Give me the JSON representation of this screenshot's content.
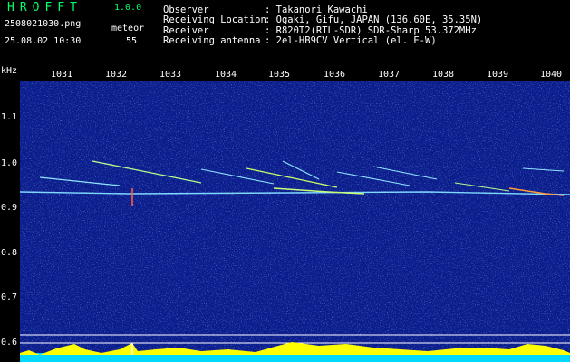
{
  "app": {
    "name": "HROFFT",
    "version": "1.0.0"
  },
  "file": {
    "name": "2508021030.png",
    "timestamp": "25.08.02 10:30"
  },
  "meteor": {
    "label": "meteor",
    "count": "55"
  },
  "info": [
    {
      "label": "Observer",
      "value": ": Takanori Kawachi"
    },
    {
      "label": "Receiving Location",
      "value": ": Ogaki, Gifu, JAPAN (136.60E, 35.35N)"
    },
    {
      "label": "Receiver",
      "value": ": R820T2(RTL-SDR) SDR-Sharp 53.372MHz"
    },
    {
      "label": "Receiving antenna",
      "value": ": 2el-HB9CV Vertical (el. E-W)"
    }
  ],
  "x_axis": {
    "ticks": [
      "1031",
      "1032",
      "1033",
      "1034",
      "1035",
      "1036",
      "1037",
      "1038",
      "1039",
      "1040"
    ]
  },
  "y_axis": {
    "unit": "kHz",
    "ticks": [
      "1.1",
      "1.0",
      "0.9",
      "0.8",
      "0.7",
      "0.6"
    ]
  },
  "colors": {
    "background": "#0a1a8a",
    "header_text": "#ffffff",
    "title": "#00ff66",
    "baseline": "#ffff00",
    "baseline_low": "#00e5ff"
  }
}
